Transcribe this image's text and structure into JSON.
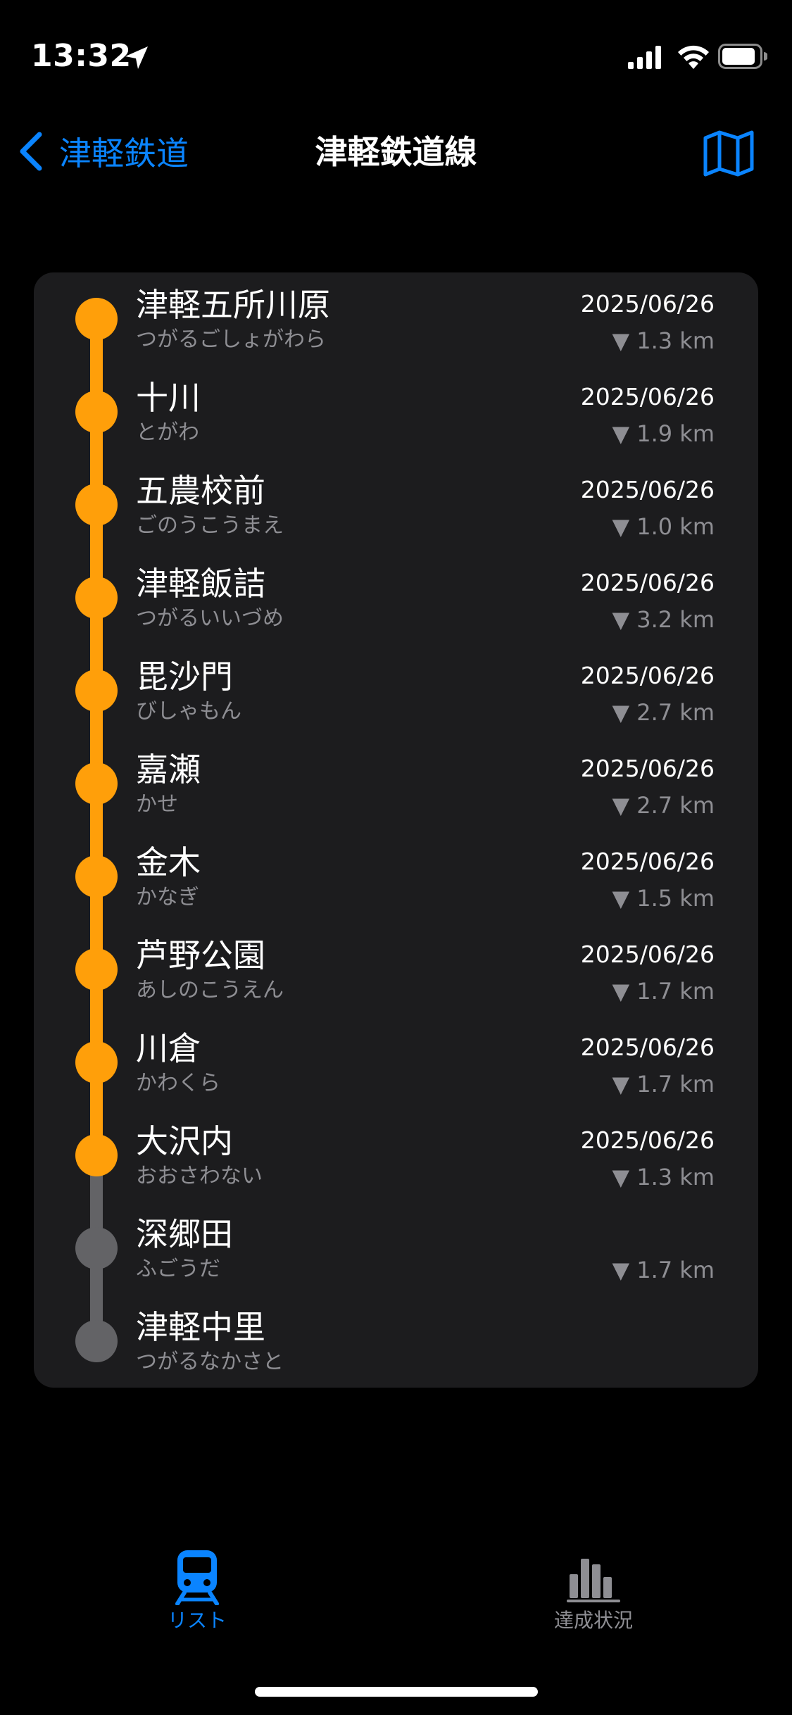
{
  "status_bar": {
    "time": "13:32",
    "icons": [
      "location-arrow-icon",
      "cellular-signal-icon",
      "wifi-icon",
      "battery-icon"
    ]
  },
  "nav": {
    "back_label": "津軽鉄道",
    "title": "津軽鉄道線",
    "right_icon": "map-icon"
  },
  "colors": {
    "accent": "#0a84ff",
    "visited": "#ff9f0a",
    "unvisited": "#636366",
    "card": "#1c1c1e"
  },
  "stations": [
    {
      "name": "津軽五所川原",
      "kana": "つがるごしょがわら",
      "date": "2025/06/26",
      "distance": "▼ 1.3 km",
      "visited": true
    },
    {
      "name": "十川",
      "kana": "とがわ",
      "date": "2025/06/26",
      "distance": "▼ 1.9 km",
      "visited": true
    },
    {
      "name": "五農校前",
      "kana": "ごのうこうまえ",
      "date": "2025/06/26",
      "distance": "▼ 1.0 km",
      "visited": true
    },
    {
      "name": "津軽飯詰",
      "kana": "つがるいいづめ",
      "date": "2025/06/26",
      "distance": "▼ 3.2 km",
      "visited": true
    },
    {
      "name": "毘沙門",
      "kana": "びしゃもん",
      "date": "2025/06/26",
      "distance": "▼ 2.7 km",
      "visited": true
    },
    {
      "name": "嘉瀬",
      "kana": "かせ",
      "date": "2025/06/26",
      "distance": "▼ 2.7 km",
      "visited": true
    },
    {
      "name": "金木",
      "kana": "かなぎ",
      "date": "2025/06/26",
      "distance": "▼ 1.5 km",
      "visited": true
    },
    {
      "name": "芦野公園",
      "kana": "あしのこうえん",
      "date": "2025/06/26",
      "distance": "▼ 1.7 km",
      "visited": true
    },
    {
      "name": "川倉",
      "kana": "かわくら",
      "date": "2025/06/26",
      "distance": "▼ 1.7 km",
      "visited": true
    },
    {
      "name": "大沢内",
      "kana": "おおさわない",
      "date": "2025/06/26",
      "distance": "▼ 1.3 km",
      "visited": true
    },
    {
      "name": "深郷田",
      "kana": "ふごうだ",
      "date": "",
      "distance": "▼ 1.7 km",
      "visited": false
    },
    {
      "name": "津軽中里",
      "kana": "つがるなかさと",
      "date": "",
      "distance": "",
      "visited": false
    }
  ],
  "tabs": [
    {
      "label": "リスト",
      "icon": "train-icon",
      "selected": true
    },
    {
      "label": "達成状況",
      "icon": "bar-chart-icon",
      "selected": false
    }
  ]
}
